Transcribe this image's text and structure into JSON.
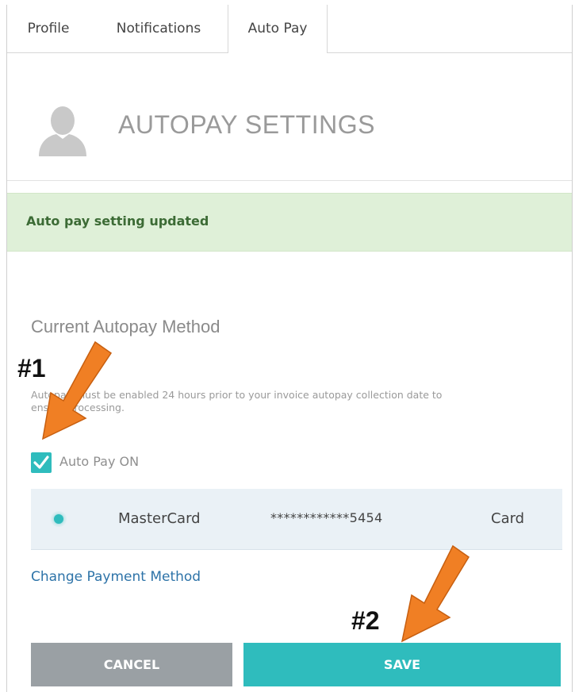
{
  "tabs": [
    {
      "label": "Profile",
      "active": false
    },
    {
      "label": "Notifications",
      "active": false
    },
    {
      "label": "Auto Pay",
      "active": true
    }
  ],
  "header": {
    "title": "AUTOPAY SETTINGS",
    "avatar_icon": "user-silhouette-icon"
  },
  "alert": {
    "message": "Auto pay setting updated",
    "color": "#dff0d8"
  },
  "section": {
    "title": "Current Autopay Method",
    "note": "Autopay must be enabled 24 hours prior to your invoice autopay collection date to ensure processing."
  },
  "autopay_checkbox": {
    "label": "Auto Pay ON",
    "checked": true
  },
  "payment_method": {
    "selected": true,
    "brand": "MasterCard",
    "number": "************5454",
    "type": "Card"
  },
  "change_link": "Change Payment Method",
  "buttons": {
    "cancel": "CANCEL",
    "save": "SAVE"
  },
  "annotations": {
    "step1": "#1",
    "step2": "#2",
    "arrow_color": "#f07f24"
  },
  "colors": {
    "accent": "#2fbcbd",
    "link": "#2d73a8",
    "cancel": "#9aa0a4"
  }
}
